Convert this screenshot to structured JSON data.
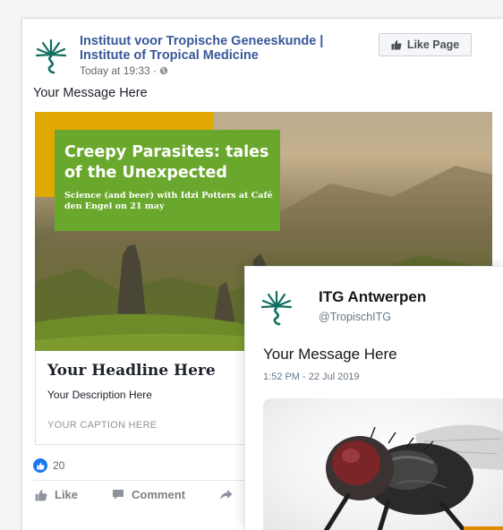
{
  "facebook": {
    "page_name": "Instituut voor Tropische Geneeskunde | Institute of Tropical Medicine",
    "timestamp": "Today at 19:33 ·",
    "like_page_label": "Like Page",
    "message": "Your Message Here",
    "banner": {
      "title": "Creepy Parasites: tales of the Unexpected",
      "subtitle": "Science (and beer) with Idzi Potters at Café den Engel on 21 may"
    },
    "link": {
      "headline": "Your Headline Here",
      "description": "Your Description Here",
      "caption": "YOUR CAPTION HERE"
    },
    "reaction_count": "20",
    "actions": {
      "like": "Like",
      "comment": "Comment"
    }
  },
  "twitter": {
    "name": "ITG Antwerpen",
    "handle": "@TropischITG",
    "message": "Your Message Here",
    "timestamp": "1:52 PM - 22 Jul 2019"
  },
  "colors": {
    "fb_link_blue": "#385898",
    "fb_like_blue": "#1877f2",
    "banner_green": "#6aa82d",
    "banner_yellow": "#e0a800",
    "logo_teal": "#0f6e5e",
    "tw_orange": "#e08a00"
  },
  "icons": [
    "itg-logo-icon",
    "globe-icon",
    "thumbs-up-icon",
    "comment-icon",
    "share-icon"
  ]
}
